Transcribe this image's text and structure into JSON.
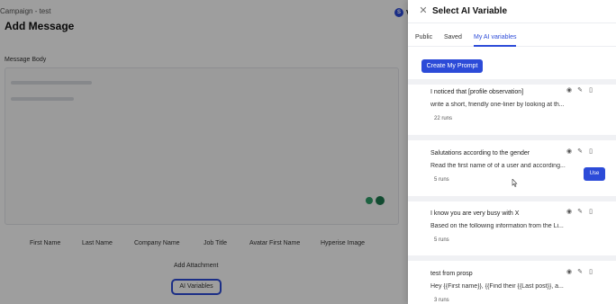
{
  "background": {
    "breadcrumb": "Campaign - test",
    "title": "Add Message",
    "user_badge": "S",
    "user_initial": "V",
    "message_body_label": "Message Body",
    "variables": [
      "First Name",
      "Last Name",
      "Company Name",
      "Job Title",
      "Avatar First Name",
      "Hyperise Image"
    ],
    "add_attachment": "Add Attachment",
    "ai_variables_button": "AI Variables"
  },
  "drawer": {
    "close_icon": "close-icon",
    "title": "Select AI Variable",
    "tabs": [
      {
        "label": "Public",
        "active": false
      },
      {
        "label": "Saved",
        "active": false
      },
      {
        "label": "My AI variables",
        "active": true
      }
    ],
    "create_button": "Create My Prompt",
    "cards": [
      {
        "title": "I noticed that [profile observation]",
        "desc": "write a short, friendly one-liner by looking at th...",
        "runs": "22 runs"
      },
      {
        "title": "Salutations according to the gender",
        "desc": "Read the first name of of a user and according...",
        "runs": "5 runs"
      },
      {
        "title": "I know you are very busy with X",
        "desc": "Based on the following information from the Li...",
        "runs": "5 runs"
      },
      {
        "title": "test from prosp",
        "desc": "Hey {{First name}}, {{Find their {{Last post}}, a...",
        "runs": "3 runs"
      }
    ],
    "use_button": "Use"
  },
  "colors": {
    "accent": "#2c4bd8",
    "overlay": "rgba(0,0,0,0.38)"
  }
}
